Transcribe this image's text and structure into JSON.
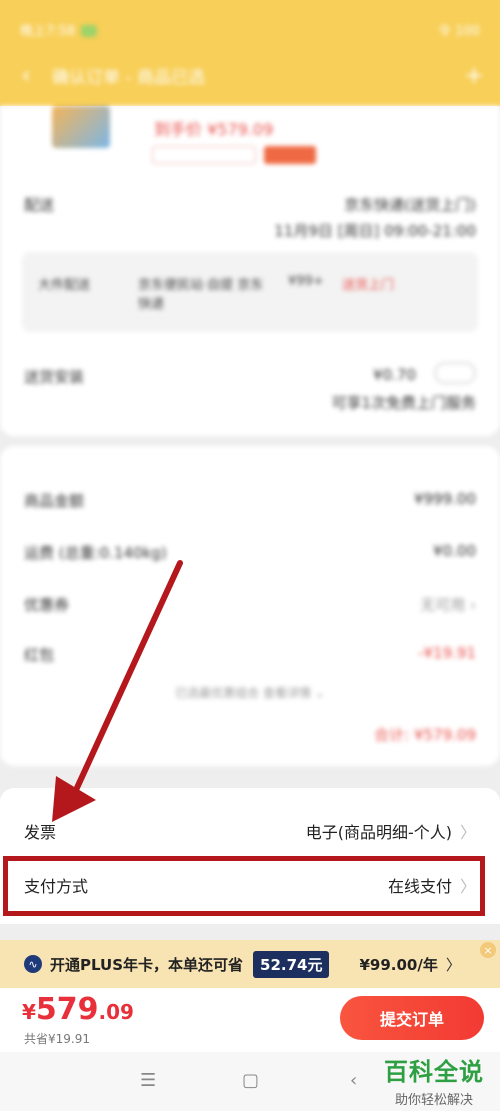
{
  "status_bar": {
    "time": "晚上7:58",
    "right": "令 100"
  },
  "nav": {
    "back_glyph": "‹",
    "title": "确认订单 - 商品已选",
    "more_glyph": "+"
  },
  "product": {
    "price_label": "到手价 ¥579.09"
  },
  "delivery": {
    "label": "配送",
    "carrier": "京东快递(送货上门)",
    "time": "11月9日 [周日] 09:00-21:00"
  },
  "shipping_box": {
    "col1": "大件配送",
    "col2": "京东便民站·自提 京东快递",
    "col3": "¥99+",
    "col4": "送货上门"
  },
  "service": {
    "label": "送货安装",
    "value": "¥0.70",
    "sub": "可享1次免费上门服务"
  },
  "summary": {
    "rows": [
      {
        "label": "商品金额",
        "value": "¥999.00"
      },
      {
        "label": "运费 (总重:0.140kg)",
        "value": "¥0.00"
      },
      {
        "label": "优惠券",
        "value": "无可用 ›"
      },
      {
        "label": "红包",
        "value": "-¥19.91"
      }
    ],
    "hint": "已选最优惠组合 查看详情 ⌄",
    "total_line": "合计: ¥579.09"
  },
  "invoice": {
    "label": "发票",
    "value": "电子(商品明细-个人)",
    "chevron": "〉"
  },
  "payment": {
    "label": "支付方式",
    "value": "在线支付",
    "chevron": "〉"
  },
  "plus_banner": {
    "icon": "∿",
    "text": "开通PLUS年卡，本单还可省",
    "badge": "52.74元",
    "price": "¥99.00/年",
    "arrow": "〉",
    "close": "×"
  },
  "bottom": {
    "currency": "¥",
    "amount_int": "579",
    "amount_dec": ".09",
    "saved": "共省¥19.91",
    "submit": "提交订单"
  },
  "sysnav": {
    "menu": "☰",
    "home": "▢",
    "back": "‹"
  },
  "watermark": {
    "main": "百科全说",
    "sub": "助你轻松解决"
  },
  "colors": {
    "annotation_red": "#b4181d",
    "accent_red": "#e8303a",
    "header_yellow": "#f8cf58"
  }
}
